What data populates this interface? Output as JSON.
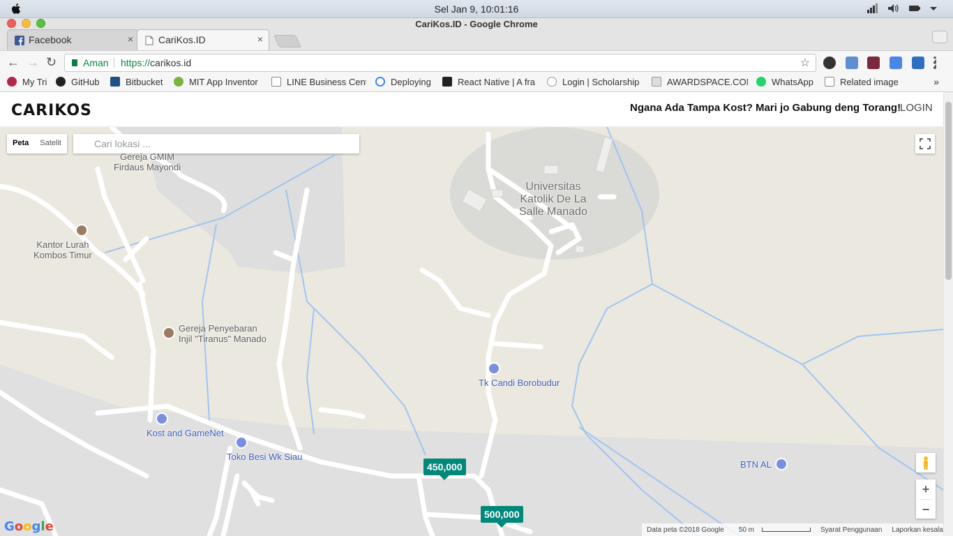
{
  "os": {
    "clock": "Sel Jan  9, 10:01:16"
  },
  "window": {
    "title": "CariKos.ID - Google Chrome"
  },
  "tabs": [
    {
      "label": "Facebook",
      "close": "×"
    },
    {
      "label": "CariKos.ID",
      "close": "×"
    }
  ],
  "toolbar": {
    "back": "←",
    "forward": "→",
    "reload": "↻",
    "secure_label": "Aman",
    "url_scheme": "https://",
    "url_host": "carikos.id",
    "star": "☆"
  },
  "bookmarks": [
    {
      "label": "My Tri",
      "icon": "my-tri-icon"
    },
    {
      "label": "GitHub",
      "icon": "github-icon"
    },
    {
      "label": "Bitbucket",
      "icon": "bitbucket-icon"
    },
    {
      "label": "MIT App Inventor",
      "icon": "mit-icon"
    },
    {
      "label": "LINE Business Center",
      "icon": "page-icon"
    },
    {
      "label": "Deploying",
      "icon": "deploy-icon"
    },
    {
      "label": "React Native | A fra",
      "icon": "react-icon"
    },
    {
      "label": "Login | Scholarship",
      "icon": "scholarship-icon"
    },
    {
      "label": "AWARDSPACE.COM",
      "icon": "awardspace-icon"
    },
    {
      "label": "WhatsApp",
      "icon": "whatsapp-icon"
    },
    {
      "label": "Related image",
      "icon": "page-icon"
    }
  ],
  "bookmarks_more": "»",
  "site": {
    "logo": "CARIKOS",
    "tagline": "Ngana Ada Tampa Kost? Mari jo Gabung deng Torang!",
    "login": "LOGIN"
  },
  "map": {
    "map_type": {
      "map": "Peta",
      "satellite": "Satelit"
    },
    "search_placeholder": "Cari lokasi ...",
    "zoom_in": "+",
    "zoom_out": "−",
    "labels": {
      "gereja_gmim": "Gereja GMIM\nFirdaus Mayondi",
      "kantor_lurah": "Kantor Lurah\nKombos Timur",
      "univ": "Universitas\nKatolik De La\nSalle Manado",
      "gereja_penyebaran": "Gereja Penyebaran\nInjil \"Tiranus\" Manado",
      "tk_candi": "Tk Candi Borobudur",
      "kost_game": "Kost and GameNet",
      "toko_besi": "Toko Besi Wk Siau",
      "btn_al": "BTN AL"
    },
    "prices": [
      "450,000",
      "500,000"
    ],
    "google_logo": "Google",
    "attribution": {
      "data": "Data peta ©2018 Google",
      "scale": "50 m",
      "terms": "Syarat Penggunaan",
      "report": "Laporkan kesalahan peta"
    }
  },
  "colors": {
    "accent_green": "#00887a",
    "secure_green": "#0b8043",
    "poi_blue": "#7b8fe0",
    "poi_brown": "#9e7b63",
    "water": "#9fc4f3"
  }
}
